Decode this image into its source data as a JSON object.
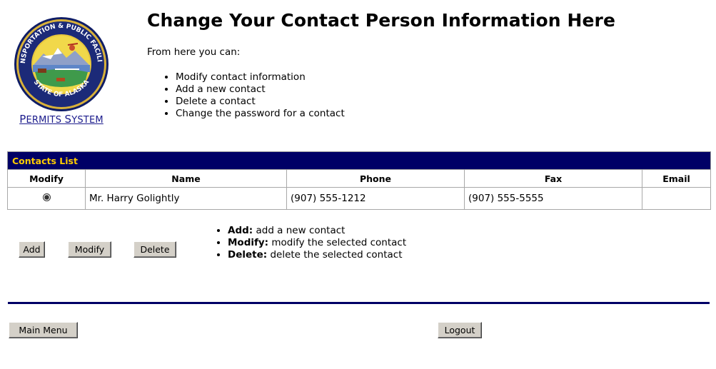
{
  "logo": {
    "caption": "Permits System",
    "seal_text": "TRANSPORTATION & PUBLIC FACILITIES · STATE OF ALASKA"
  },
  "header": {
    "title": "Change Your Contact Person Information Here",
    "intro": "From here you can:",
    "bullets": [
      "Modify contact information",
      "Add a new contact",
      "Delete a contact",
      "Change the password for a contact"
    ]
  },
  "contacts": {
    "caption": "Contacts List",
    "columns": [
      "Modify",
      "Name",
      "Phone",
      "Fax",
      "Email"
    ],
    "rows": [
      {
        "selected": true,
        "name": "Mr. Harry Golightly",
        "phone": "(907) 555-1212",
        "fax": "(907) 555-5555",
        "email": ""
      }
    ]
  },
  "actions": {
    "add_label": "Add",
    "modify_label": "Modify",
    "delete_label": "Delete",
    "help": [
      {
        "term": "Add:",
        "desc": " add a new contact"
      },
      {
        "term": "Modify:",
        "desc": " modify the selected contact"
      },
      {
        "term": "Delete:",
        "desc": " delete the selected contact"
      }
    ]
  },
  "footer": {
    "main_menu_label": "Main Menu",
    "logout_label": "Logout"
  },
  "colors": {
    "navy": "#000066",
    "gold": "#ffcc00",
    "link": "#1b1b8c"
  }
}
